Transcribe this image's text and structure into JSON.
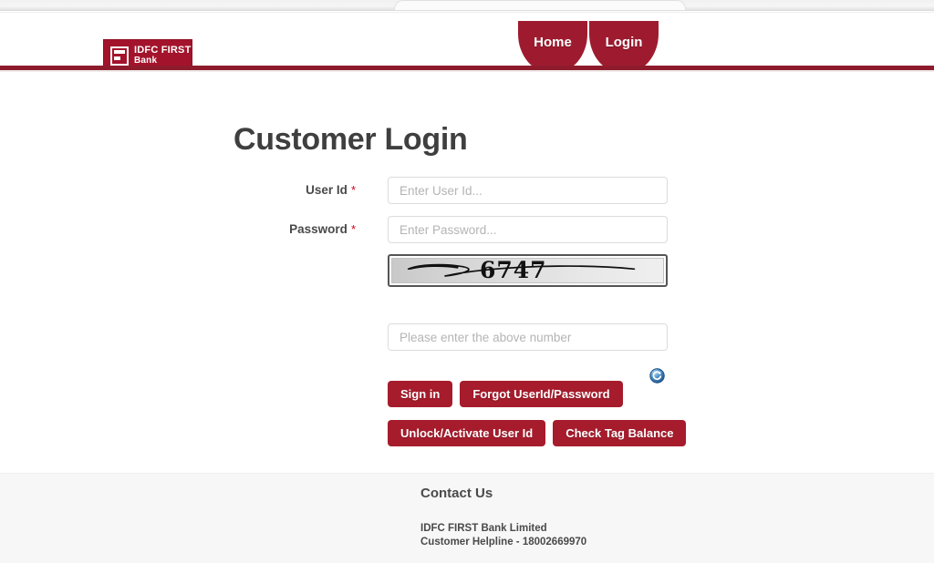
{
  "browser": {
    "tab_strip_visible": true
  },
  "header": {
    "logo": {
      "icon": "idfc-first-bank-logo-icon",
      "line1": "IDFC FIRST",
      "line2": "Bank",
      "background_color": "#a3132b"
    },
    "nav": {
      "items": [
        {
          "label": "Home",
          "active": false
        },
        {
          "label": "Login",
          "active": true
        }
      ],
      "tab_color": "#9e1b2f"
    },
    "rule_color": "#8e1b2c"
  },
  "main": {
    "title": "Customer Login",
    "fields": [
      {
        "label": "User Id",
        "required_marker": "*",
        "placeholder": "Enter User Id...",
        "value": "",
        "type": "text"
      },
      {
        "label": "Password",
        "required_marker": "*",
        "placeholder": "Enter Password...",
        "value": "",
        "type": "password"
      }
    ],
    "captcha": {
      "code": "6747",
      "refresh_icon": "refresh-icon",
      "input_placeholder": "Please enter the above number",
      "input_value": ""
    },
    "buttons": [
      {
        "label": "Sign in",
        "name": "sign-in-button"
      },
      {
        "label": "Forgot UserId/Password",
        "name": "forgot-credentials-button"
      },
      {
        "label": "Unlock/Activate User Id",
        "name": "unlock-activate-button"
      },
      {
        "label": "Check Tag Balance",
        "name": "check-tag-balance-button"
      }
    ],
    "button_color": "#a61c2c"
  },
  "footer": {
    "title": "Contact Us",
    "company": "IDFC FIRST Bank Limited",
    "helpline": "Customer Helpline - 18002669970",
    "background_color": "#f7f7f7"
  }
}
